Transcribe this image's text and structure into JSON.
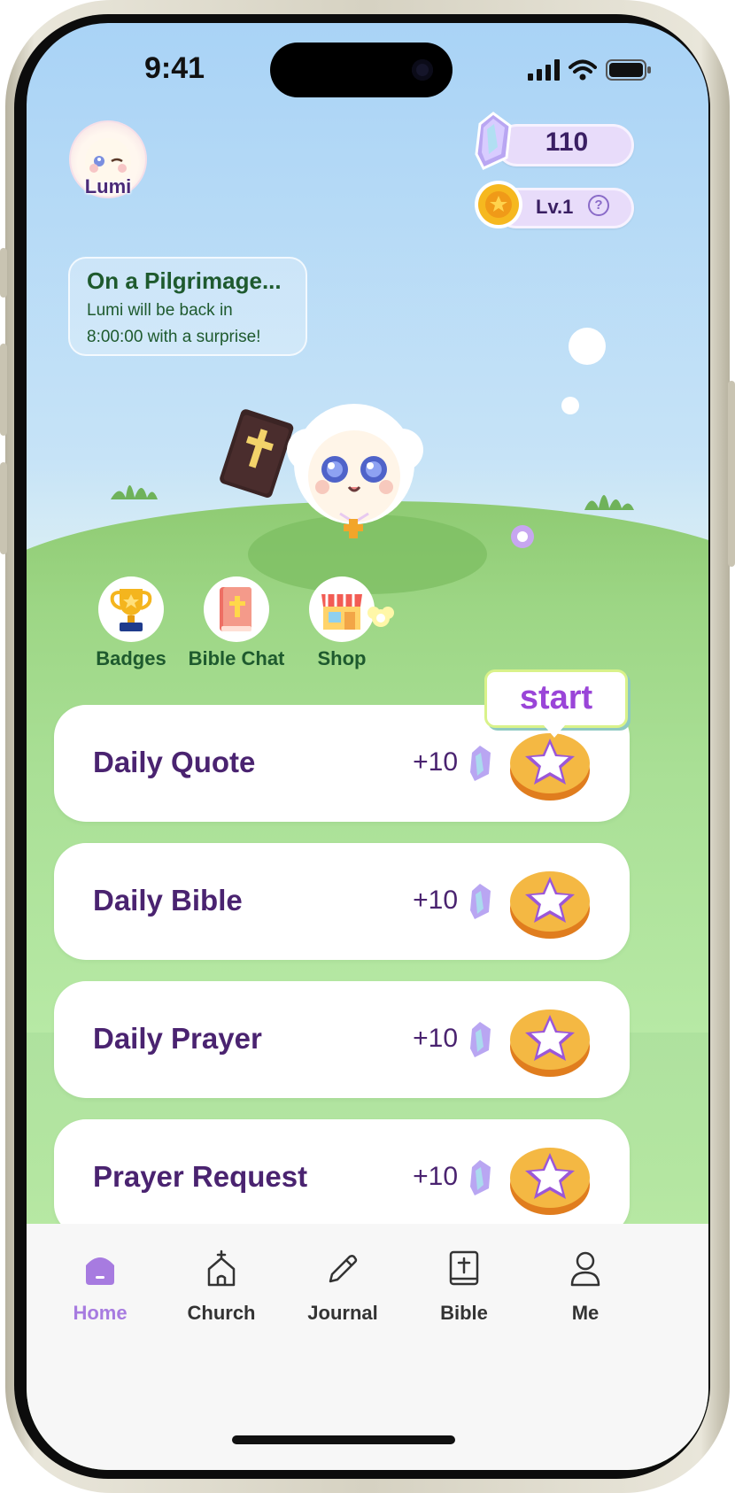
{
  "status_bar": {
    "time": "9:41"
  },
  "profile": {
    "name": "Lumi"
  },
  "stats": {
    "gems": "110",
    "level": "Lv.1",
    "help_icon": "?"
  },
  "status_message": {
    "title": "On a Pilgrimage...",
    "line1": "Lumi will be back in",
    "line2": "8:00:00 with a surprise!"
  },
  "quick_actions": [
    {
      "label": "Badges",
      "icon": "trophy-icon"
    },
    {
      "label": "Bible Chat",
      "icon": "bible-book-icon"
    },
    {
      "label": "Shop",
      "icon": "shop-icon"
    }
  ],
  "start_tooltip": "start",
  "tasks": [
    {
      "title": "Daily Quote",
      "reward": "+10"
    },
    {
      "title": "Daily Bible",
      "reward": "+10"
    },
    {
      "title": "Daily Prayer",
      "reward": "+10"
    },
    {
      "title": "Prayer Request",
      "reward": "+10"
    }
  ],
  "tabs": [
    {
      "label": "Home",
      "icon": "home-icon",
      "active": true
    },
    {
      "label": "Church",
      "icon": "church-icon",
      "active": false
    },
    {
      "label": "Journal",
      "icon": "pencil-icon",
      "active": false
    },
    {
      "label": "Bible",
      "icon": "bible-icon",
      "active": false
    },
    {
      "label": "Me",
      "icon": "person-icon",
      "active": false
    }
  ],
  "colors": {
    "accent_purple": "#a77be0",
    "title_purple": "#4a2370",
    "leaf_green": "#1e5a2e",
    "coin_gold": "#f0b43c"
  }
}
